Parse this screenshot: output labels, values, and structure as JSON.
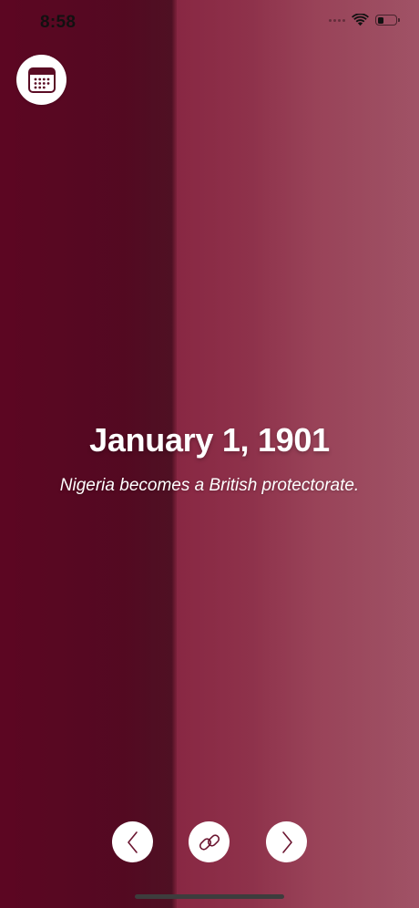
{
  "status_bar": {
    "time": "8:58",
    "battery_level": 0.35
  },
  "event": {
    "date": "January 1, 1901",
    "description": "Nigeria becomes a British protectorate."
  },
  "icons": {
    "calendar": "calendar-icon",
    "previous": "chevron-left-icon",
    "link": "link-icon",
    "next": "chevron-right-icon"
  },
  "colors": {
    "background_left": "#5e0623",
    "background_right": "#984459",
    "accent": "#86233f",
    "button_bg": "#ffffff"
  }
}
